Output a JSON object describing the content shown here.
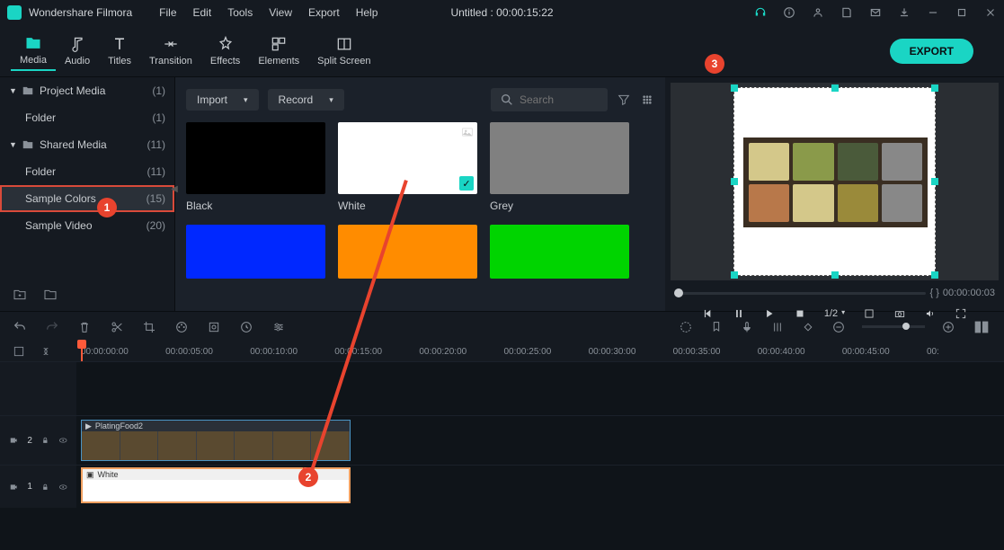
{
  "app": {
    "name": "Wondershare Filmora",
    "document": "Untitled : 00:00:15:22"
  },
  "menu": [
    "File",
    "Edit",
    "Tools",
    "View",
    "Export",
    "Help"
  ],
  "tabs": [
    {
      "label": "Media",
      "active": true
    },
    {
      "label": "Audio"
    },
    {
      "label": "Titles"
    },
    {
      "label": "Transition"
    },
    {
      "label": "Effects"
    },
    {
      "label": "Elements"
    },
    {
      "label": "Split Screen"
    }
  ],
  "export_btn": "EXPORT",
  "sidebar": [
    {
      "label": "Project Media",
      "count": "(1)",
      "folder": true,
      "expand": true
    },
    {
      "label": "Folder",
      "count": "(1)",
      "indent": true
    },
    {
      "label": "Shared Media",
      "count": "(11)",
      "folder": true,
      "expand": true
    },
    {
      "label": "Folder",
      "count": "(11)",
      "indent": true
    },
    {
      "label": "Sample Colors",
      "count": "(15)",
      "selected": true,
      "indent": true
    },
    {
      "label": "Sample Video",
      "count": "(20)",
      "indent": true
    }
  ],
  "content": {
    "import": "Import",
    "record": "Record",
    "search_ph": "Search",
    "thumbs": [
      {
        "label": "Black",
        "color": "#000000"
      },
      {
        "label": "White",
        "color": "#ffffff",
        "checked": true
      },
      {
        "label": "Grey",
        "color": "#808080"
      },
      {
        "label": "",
        "color": "#0028ff"
      },
      {
        "label": "",
        "color": "#ff8c00"
      },
      {
        "label": "",
        "color": "#00d400"
      }
    ]
  },
  "preview": {
    "time_left": "{    }",
    "time_right": "00:00:00:03",
    "speed": "1/2"
  },
  "ruler": [
    "00:00:00:00",
    "00:00:05:00",
    "00:00:10:00",
    "00:00:15:00",
    "00:00:20:00",
    "00:00:25:00",
    "00:00:30:00",
    "00:00:35:00",
    "00:00:40:00",
    "00:00:45:00",
    "00:"
  ],
  "tracks": {
    "v2_label": "2",
    "v1_label": "1",
    "clip_video": "PlatingFood2",
    "clip_white": "White"
  },
  "callouts": {
    "c1": "1",
    "c2": "2",
    "c3": "3"
  }
}
